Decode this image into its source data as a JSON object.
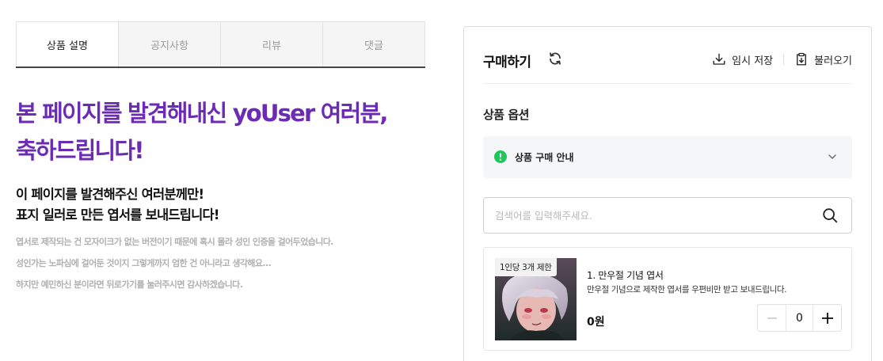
{
  "tabs": [
    {
      "label": "상품 설명",
      "active": true
    },
    {
      "label": "공지사항",
      "active": false
    },
    {
      "label": "리뷰",
      "active": false
    },
    {
      "label": "댓글",
      "active": false
    }
  ],
  "hero": {
    "line1": "본 페이지를 발견해내신 yoUser 여러분,",
    "line2": "축하드립니다!"
  },
  "sub": {
    "line1": "이 페이지를 발견해주신 여러분께만!",
    "line2": "표지 일러로 만든 엽서를 보내드립니다!"
  },
  "desc": [
    "엽서로 제작되는 건 모자이크가 없는 버전이기 때문에 혹시 몰라 성인 인증을 걸어두었습니다.",
    "성인가는 노파심에 걸어둔 것이지 그렇게까지 엄한 건 아니라고 생각해요...",
    "하지만 예민하신 분이라면 뒤로가기를 눌러주시면 감사하겠습니다."
  ],
  "panel": {
    "title": "구매하기",
    "refresh_icon": "refresh-icon",
    "temp_save_label": "임시 저장",
    "load_label": "불러오기",
    "options_label": "상품 옵션",
    "notice_label": "상품 구매 안내",
    "search_placeholder": "검색어를 입력해주세요.",
    "product": {
      "badge": "1인당 3개 제한",
      "name": "1. 만우절 기념 엽서",
      "description": "만우절 기념으로 제작한 엽서를 우편비만 받고 보내드립니다.",
      "price": "0원",
      "quantity": "0"
    }
  },
  "colors": {
    "hero": "#6b2bb3",
    "notice_icon": "#22c55e",
    "tab_underline": "#444444"
  }
}
